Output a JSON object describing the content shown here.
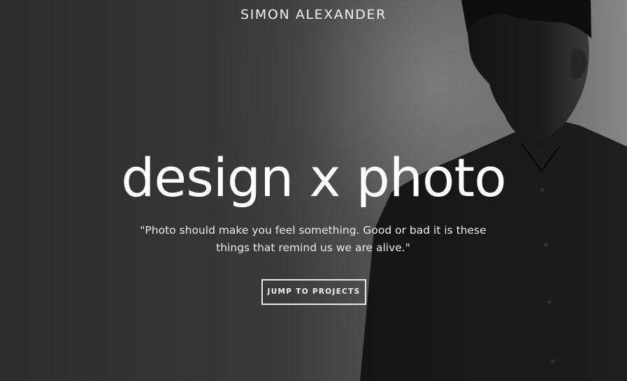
{
  "header": {
    "brand": "SIMON ALEXANDER"
  },
  "hero": {
    "headline": "design x photo",
    "quote": "\"Photo should make you feel something. Good or bad it is these things that remind us we are alive.\"",
    "cta_label": "JUMP TO PROJECTS"
  },
  "colors": {
    "text": "#ffffff",
    "background_dark": "#2c2c2c",
    "background_light": "#8a8a8a",
    "silhouette": "#121212"
  }
}
